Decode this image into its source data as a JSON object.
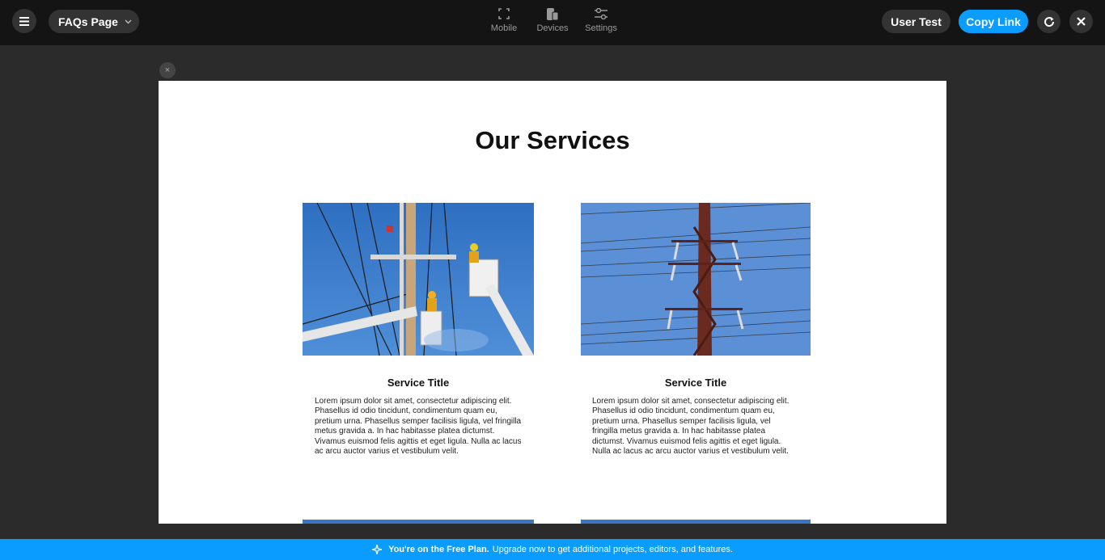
{
  "topbar": {
    "page_name": "FAQs Page",
    "tools": [
      {
        "label": "Mobile",
        "icon": "mobile-frame-icon"
      },
      {
        "label": "Devices",
        "icon": "devices-icon"
      },
      {
        "label": "Settings",
        "icon": "settings-sliders-icon"
      }
    ],
    "user_test_label": "User Test",
    "copy_link_label": "Copy Link"
  },
  "preview": {
    "close_glyph": "×",
    "heading": "Our Services",
    "cards": [
      {
        "title": "Service Title",
        "body": "Lorem ipsum dolor sit amet, consectetur adipiscing elit. Phasellus id odio tincidunt, condimentum quam eu, pretium urna. Phasellus semper facilisis ligula, vel fringilla metus gravida a. In hac habitasse platea dictumst. Vivamus euismod felis  agittis et eget ligula. Nulla ac lacus ac arcu auctor varius et vestibulum velit."
      },
      {
        "title": "Service Title",
        "body": "Lorem ipsum dolor sit amet, consectetur adipiscing elit. Phasellus id odio tincidunt, condimentum quam eu, pretium urna. Phasellus semper facilisis ligula, vel fringilla metus gravida a. In hac habitasse platea dictumst. Vivamus euismod felis  agittis et eget ligula. Nulla ac lacus ac arcu auctor varius et vestibulum velit."
      }
    ]
  },
  "banner": {
    "bold": "You're on the Free Plan.",
    "text": "Upgrade now to get additional projects, editors, and features."
  },
  "colors": {
    "accent": "#0a9dff",
    "topbar": "#141414",
    "canvas": "#2b2b2b"
  }
}
